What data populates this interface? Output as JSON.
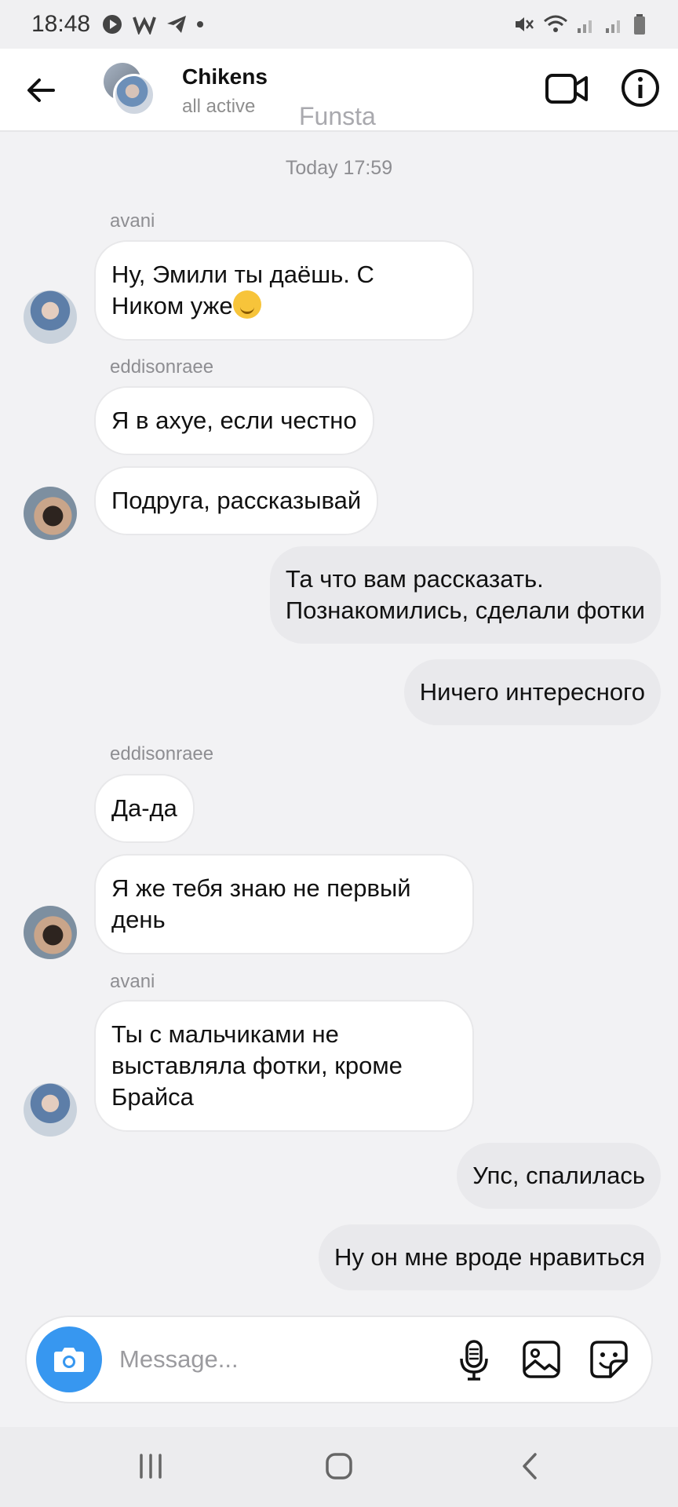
{
  "status_bar": {
    "time": "18:48"
  },
  "header": {
    "title": "Chikens",
    "subtitle": "all active",
    "watermark": "Funsta"
  },
  "chat": {
    "timestamp": "Today 17:59",
    "senders": {
      "avani_1": "avani",
      "eddison_1": "eddisonraee",
      "eddison_2": "eddisonraee",
      "avani_2": "avani"
    },
    "messages": {
      "m1_line1": "Ну, Эмили ты даёшь. С",
      "m1_line2": "Ником уже",
      "m2": "Я в ахуе, если честно",
      "m3": "Подруга, рассказывай",
      "m4_line1": "Та что вам рассказать.",
      "m4_line2": "Познакомились, сделали фотки",
      "m5": "Ничего интересного",
      "m6": "Да-да",
      "m7_line1": "Я же тебя знаю не первый",
      "m7_line2": "день",
      "m8_line1": "Ты с мальчиками не",
      "m8_line2": "выставляла фотки, кроме",
      "m8_line3": "Брайса",
      "m9": "Упс, спалилась",
      "m10": "Ну он мне вроде нравиться"
    }
  },
  "composer": {
    "placeholder": "Message..."
  },
  "colors": {
    "accent": "#3797f0",
    "bubble_out": "#e9e9ec",
    "bubble_in": "#ffffff"
  },
  "icons": [
    "back-arrow-icon",
    "video-call-icon",
    "info-icon",
    "camera-icon",
    "microphone-icon",
    "gallery-icon",
    "sticker-icon",
    "smirk-emoji-icon"
  ]
}
